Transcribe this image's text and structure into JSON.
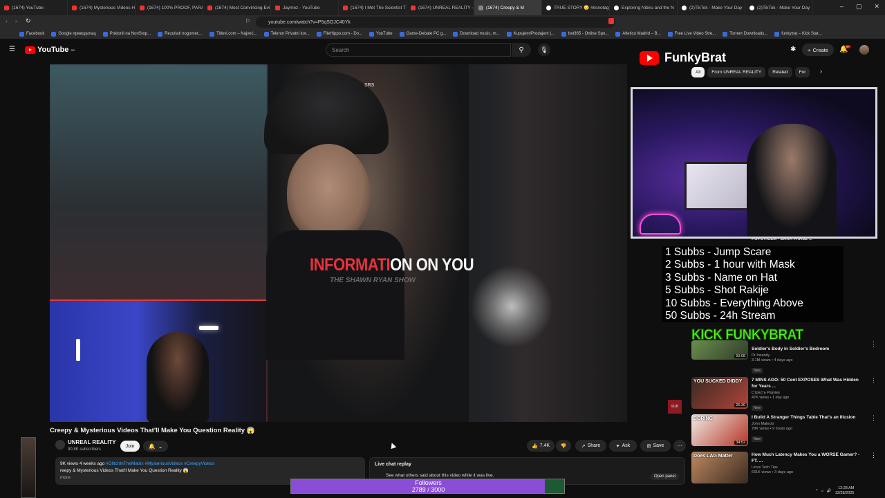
{
  "browser": {
    "tabs": [
      {
        "label": "(1674) YouTube",
        "icon": "youtube-icon",
        "active": false
      },
      {
        "label": "(1674) Mysterious Videos H",
        "icon": "youtube-icon",
        "active": false
      },
      {
        "label": "(1674) 100% PROOF, PARA",
        "icon": "youtube-icon",
        "active": false
      },
      {
        "label": "(1674) Most Convincing Evi",
        "icon": "youtube-icon",
        "active": false
      },
      {
        "label": "Jaymez - YouTube",
        "icon": "youtube-icon",
        "active": false
      },
      {
        "label": "(1674) I Met The Scientist T",
        "icon": "youtube-icon",
        "active": false
      },
      {
        "label": "(1674) UNREAL REALITY - Y",
        "icon": "youtube-icon",
        "active": false
      },
      {
        "label": "(1674) Creepy & M",
        "icon": "speaker-icon",
        "active": true
      },
      {
        "label": "TRUE STORY 😳 #itsnotag",
        "icon": "tiktok-icon",
        "active": false
      },
      {
        "label": "Exploring Nibiru and the N",
        "icon": "tiktok-icon",
        "active": false
      },
      {
        "label": "(2)TikTok - Make Your Day",
        "icon": "tiktok-icon",
        "active": false
      },
      {
        "label": "(2)TikTok - Make Your Day",
        "icon": "tiktok-icon",
        "active": false
      }
    ],
    "url": "youtube.com/watch?v=P5qSOJC40Yk",
    "bookmarks": [
      "Facebook",
      "Google преводилац",
      "Poklonil na NonStop...",
      "Rezultati nogomet,...",
      "Titlovi.com – Najveć...",
      "Telenor Privatni kor...",
      "FileHippo.com - Do...",
      "YouTube",
      "Game-Debate PC g...",
      "Download music, m...",
      "Kupujem/Prodajem |...",
      "bet365 - Online Spo...",
      "Atletico Madrid – B...",
      "Free Live Video Stre...",
      "Torrent Downloads...",
      "funkytrat – Kick Stat..."
    ]
  },
  "youtube": {
    "logo_text": "YouTube",
    "logo_region": "RS",
    "search_placeholder": "Search",
    "create_label": "Create",
    "notif_count": "9+",
    "video": {
      "caption_red": "INFORMATI",
      "caption_white": "ON ON YOU",
      "source": "THE SHAWN RYAN SHOW",
      "cap_logo": "SRS",
      "title": "Creepy & Mysterious Videos That'll Make You Question Reality 😱"
    },
    "channel": {
      "name": "UNREAL REALITY",
      "subs": "90.8K subscribers",
      "join": "Join"
    },
    "actions": {
      "likes": "7.4K",
      "share": "Share",
      "ask": "Ask",
      "save": "Save"
    },
    "description": {
      "meta": "9K views  4 weeks ago",
      "tags": "#GlitchInTheMatrix #MysteriousVideos #CreepyVideos",
      "text": "reepy & Mysterious Videos That'll Make You Question Reality 😱",
      "more": "more"
    },
    "live_chat": {
      "title": "Live chat replay",
      "subtitle": "See what others said about this video while it was live.",
      "open_panel": "Open panel"
    },
    "chips": [
      "All",
      "From UNREAL REALITY",
      "Related",
      "For"
    ],
    "recs": [
      {
        "title": "Soldier's Body in Soldier's Bedroom",
        "channel": "Dr Insanity",
        "meta": "3.1M views • 4 days ago",
        "badge": "New",
        "duration": "50:08"
      },
      {
        "title": "7 MINS AGO: 50 Cent EXPOSES What Was Hidden for Years ...",
        "channel": "Страсть Разума",
        "meta": "47K views • 1 day ago",
        "badge": "New",
        "duration": "26:30",
        "thumb_text": "YOU SUCKED DIDDY"
      },
      {
        "title": "I Build A Stranger Things Table That's an Illusion",
        "channel": "John Malecki",
        "meta": "78K views • 9 hours ago",
        "badge": "New",
        "duration": "34:52",
        "thumb_text": "BORING"
      },
      {
        "title": "How Much Latency Makes You a WORSE Gamer? - FT. ...",
        "channel": "Linus Tech Tips",
        "meta": "631K views • 3 days ago",
        "badge": "",
        "duration": "",
        "thumb_text": "Does LAG Matter"
      }
    ],
    "popovic": "POPOVICEM - BAKA PRASE ..."
  },
  "overlay": {
    "streamer_name": "FunkyBrat",
    "kick_logo": "KICK FUNKYBRAT",
    "goals": [
      "1 Subbs - Jump Scare",
      "2 Subbs - 1 hour with Mask",
      "3 Subbs - Name on Hat",
      "5 Subbs - Shot Rakije",
      "10 Subbs - Everything Above",
      "50 Subbs - 24h Stream"
    ],
    "followers": {
      "label": "Followers",
      "current": 2789,
      "target": 3000,
      "text": "2789 / 3000"
    },
    "sub_icon_text": "SUB"
  },
  "system": {
    "time": "12:28 AM",
    "date": "12/28/2025"
  },
  "colors": {
    "youtube_red": "#ff0000",
    "followers_fill": "#8a4dd6",
    "followers_bg": "#1d5a31",
    "kick_green": "#53fc18"
  }
}
